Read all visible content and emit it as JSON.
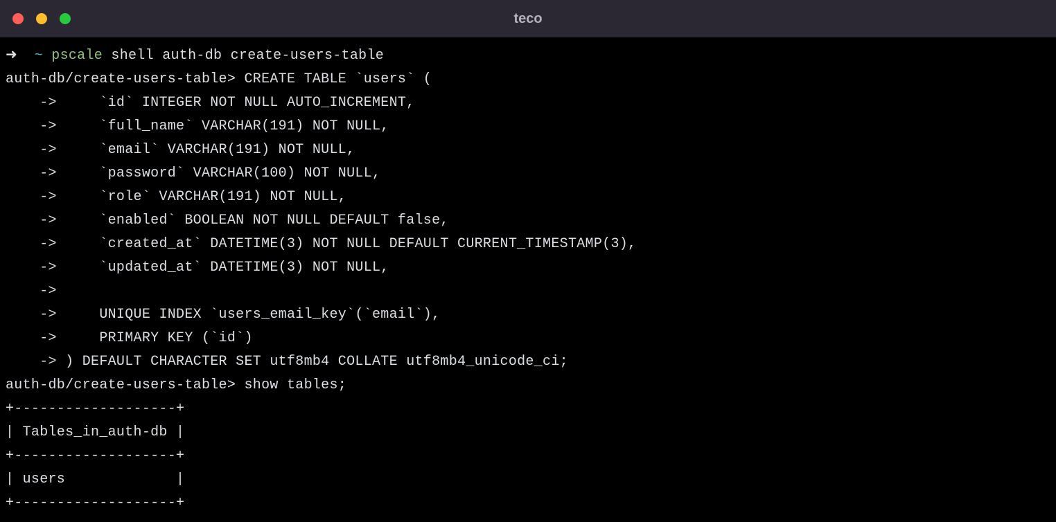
{
  "window": {
    "title": "teco"
  },
  "line1": {
    "arrow": "➜  ",
    "tilde": "~ ",
    "pscale": "pscale",
    "rest": " shell auth-db create-users-table"
  },
  "prompt1": "auth-db/create-users-table> ",
  "sql1": "CREATE TABLE `users` (",
  "cont_prefix": "    -> ",
  "cont_lines": [
    "    `id` INTEGER NOT NULL AUTO_INCREMENT,",
    "    `full_name` VARCHAR(191) NOT NULL,",
    "    `email` VARCHAR(191) NOT NULL,",
    "    `password` VARCHAR(100) NOT NULL,",
    "    `role` VARCHAR(191) NOT NULL,",
    "    `enabled` BOOLEAN NOT NULL DEFAULT false,",
    "    `created_at` DATETIME(3) NOT NULL DEFAULT CURRENT_TIMESTAMP(3),",
    "    `updated_at` DATETIME(3) NOT NULL,",
    "",
    "    UNIQUE INDEX `users_email_key`(`email`),",
    "    PRIMARY KEY (`id`)",
    ") DEFAULT CHARACTER SET utf8mb4 COLLATE utf8mb4_unicode_ci;"
  ],
  "prompt2": "auth-db/create-users-table> ",
  "sql2": "show tables;",
  "table_output": [
    "+-------------------+",
    "| Tables_in_auth-db |",
    "+-------------------+",
    "| users             |",
    "+-------------------+"
  ]
}
